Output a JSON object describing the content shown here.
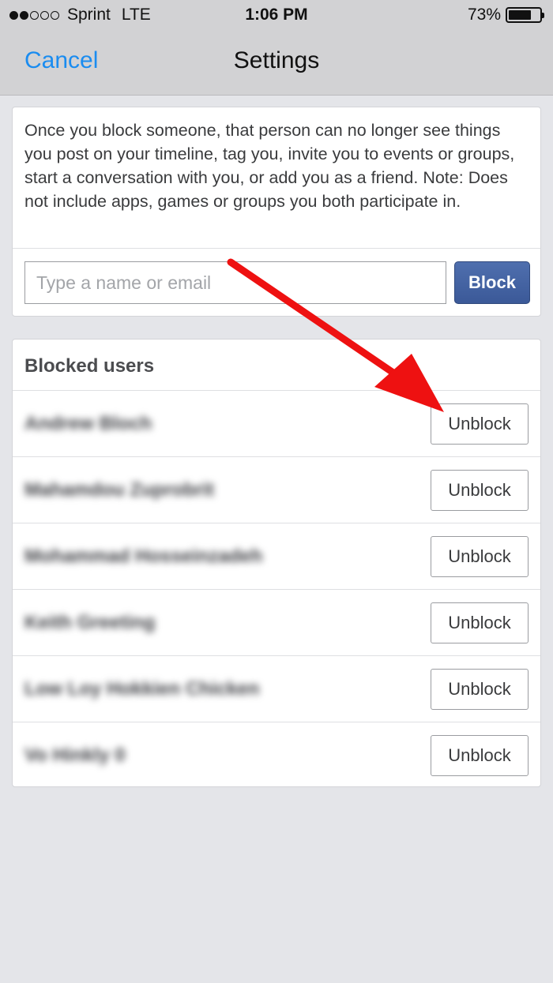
{
  "status_bar": {
    "carrier": "Sprint",
    "network": "LTE",
    "time": "1:06 PM",
    "battery": "73%",
    "battery_level": 0.73,
    "signal_bars_filled": 2,
    "signal_bars_total": 5
  },
  "nav": {
    "cancel_label": "Cancel",
    "title": "Settings"
  },
  "block_section": {
    "description": "Once you block someone, that person can no longer see things you post on your timeline, tag you, invite you to events or groups, start a conversation with you, or add you as a friend. Note: Does not include apps, games or groups you both participate in.",
    "input_value": "",
    "input_placeholder": "Type a name or email",
    "block_button_label": "Block"
  },
  "blocked_users": {
    "header": "Blocked users",
    "unblock_label": "Unblock",
    "users": [
      {
        "name": "Andrew Bloch"
      },
      {
        "name": "Mahamdou Zuprobrit"
      },
      {
        "name": "Mohammad Hosseinzadeh"
      },
      {
        "name": "Keith Greeting"
      },
      {
        "name": "Low Loy Hokkien Chicken"
      },
      {
        "name": "Vo Hinkly 0"
      }
    ]
  },
  "colors": {
    "accent": "#1a8cf0",
    "block_button": "#3b5998",
    "annotation_arrow": "#ee1111"
  }
}
